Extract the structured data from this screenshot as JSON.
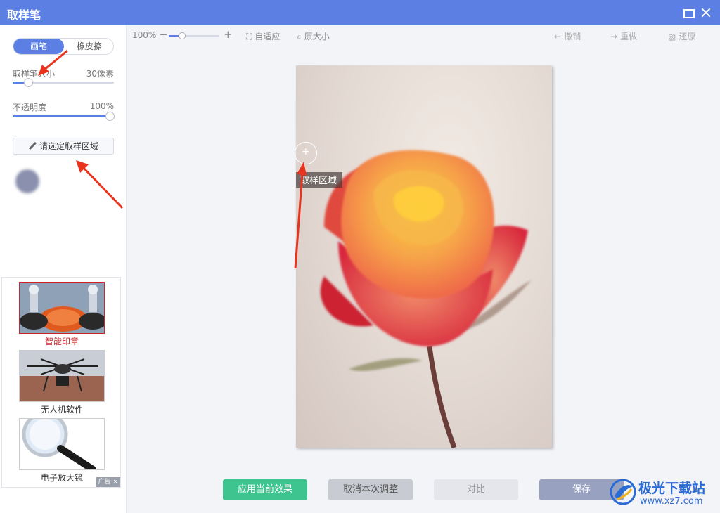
{
  "window": {
    "title": "取样笔"
  },
  "mode_tabs": {
    "brush": "画笔",
    "eraser": "橡皮擦",
    "active": "brush"
  },
  "sample_size": {
    "label": "取样笔大小",
    "value_text": "30像素",
    "fraction": 0.15
  },
  "opacity": {
    "label": "不透明度",
    "value_text": "100%",
    "fraction": 1.0
  },
  "pick_area_button": {
    "label": "请选定取样区域",
    "icon": "eyedropper-icon"
  },
  "swatch_color": "#8a90ad",
  "ads": {
    "items": [
      {
        "caption": "智能印章",
        "icon": "stamp-photo"
      },
      {
        "caption": "无人机软件",
        "icon": "drone-photo"
      },
      {
        "caption": "电子放大镜",
        "icon": "magnifier-photo"
      }
    ],
    "footer": "广告 ×"
  },
  "toolbar": {
    "zoom_text": "100%",
    "zoom_minus": "−",
    "zoom_plus": "+",
    "zoom_fraction": 0.25,
    "fit": "自适应",
    "original_size": "原大小",
    "undo": "撤销",
    "redo": "重做",
    "restore": "还原"
  },
  "canvas": {
    "tooltip": "取样区域"
  },
  "buttons": {
    "apply": "应用当前效果",
    "cancel": "取消本次调整",
    "compare": "对比",
    "save": "保存"
  },
  "watermark": {
    "line1": "极光下载站",
    "line2": "www.xz7.com"
  },
  "colors": {
    "accent": "#5b7fe3",
    "apply_green": "#3ec48e",
    "annotation_red": "#e8341f"
  }
}
